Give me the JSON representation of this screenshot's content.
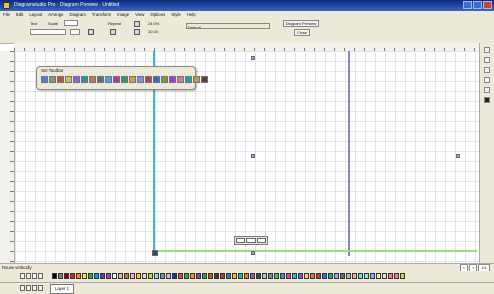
{
  "window": {
    "title": "Diagramstudio Pro · Diagram Preview · Untitled"
  },
  "menu": [
    "File",
    "Edit",
    "Layout",
    "Arrange",
    "Diagram",
    "Transform",
    "Image",
    "View",
    "Options",
    "Style",
    "Help"
  ],
  "toolbar": {
    "text_label": "Text",
    "scale_label": "Scale",
    "scale_value": "",
    "repeat_label": "Repeat",
    "zoom_value": "24.0%",
    "size_value": "10.00",
    "preset_label": "Preset",
    "preset_value": "Default",
    "diagram_preview_label": "Diagram Preview",
    "close_label": "Close"
  },
  "floating_toolbar": {
    "title": "Sel Toolbar",
    "icon_colors": [
      "#5a7fd0",
      "#7da34a",
      "#d24a3a",
      "#e6b84a",
      "#9c63c7",
      "#2f8fa8",
      "#c77a2e",
      "#6b6b6b",
      "#4fa0d8",
      "#b33a9c",
      "#3a9c5a",
      "#d8a03a",
      "#8a8ad8",
      "#c0402a",
      "#3a6ac0",
      "#7a9c2a",
      "#a03ad8",
      "#d87a7a",
      "#2a9c9c",
      "#c0a02a",
      "#6a3a2a"
    ]
  },
  "diagram": {
    "accent_teal": "#3fb7c4",
    "accent_purple": "#8a7fd0",
    "accent_green": "#9de07a"
  },
  "statusbar": {
    "status": "Rouse vertically",
    "page": "1/1"
  },
  "palette": {
    "colors": [
      "#000000",
      "#7f7f7f",
      "#880015",
      "#ed1c24",
      "#ff7f27",
      "#fff200",
      "#22b14c",
      "#00a2e8",
      "#3f48cc",
      "#a349a4",
      "#ffffff",
      "#c3c3c3",
      "#b97a57",
      "#ffaec9",
      "#ffc90e",
      "#efe4b0",
      "#b5e61d",
      "#99d9ea",
      "#7092be",
      "#c8bfe7",
      "#1f3a93",
      "#e74c3c",
      "#27ae60",
      "#f39c12",
      "#8e44ad",
      "#16a085",
      "#d35400",
      "#2c3e50",
      "#c0392b",
      "#2980b9",
      "#f1c40f",
      "#1abc9c",
      "#e67e22",
      "#9b59b6",
      "#34495e",
      "#bdc3c7",
      "#7f8c8d",
      "#2ecc71",
      "#3498db",
      "#e84393",
      "#00cec9",
      "#6c5ce7",
      "#fdcb6e",
      "#e17055",
      "#d63031",
      "#0984e3",
      "#00b894",
      "#a29bfe",
      "#636e72",
      "#b2bec3",
      "#fab1a0",
      "#55efc4",
      "#81ecec",
      "#74b9ff",
      "#ffeaa7",
      "#dfe6e9",
      "#ff7675",
      "#fd79a8",
      "#badc58"
    ]
  },
  "tabs": [
    {
      "label": "Layer 1"
    }
  ]
}
